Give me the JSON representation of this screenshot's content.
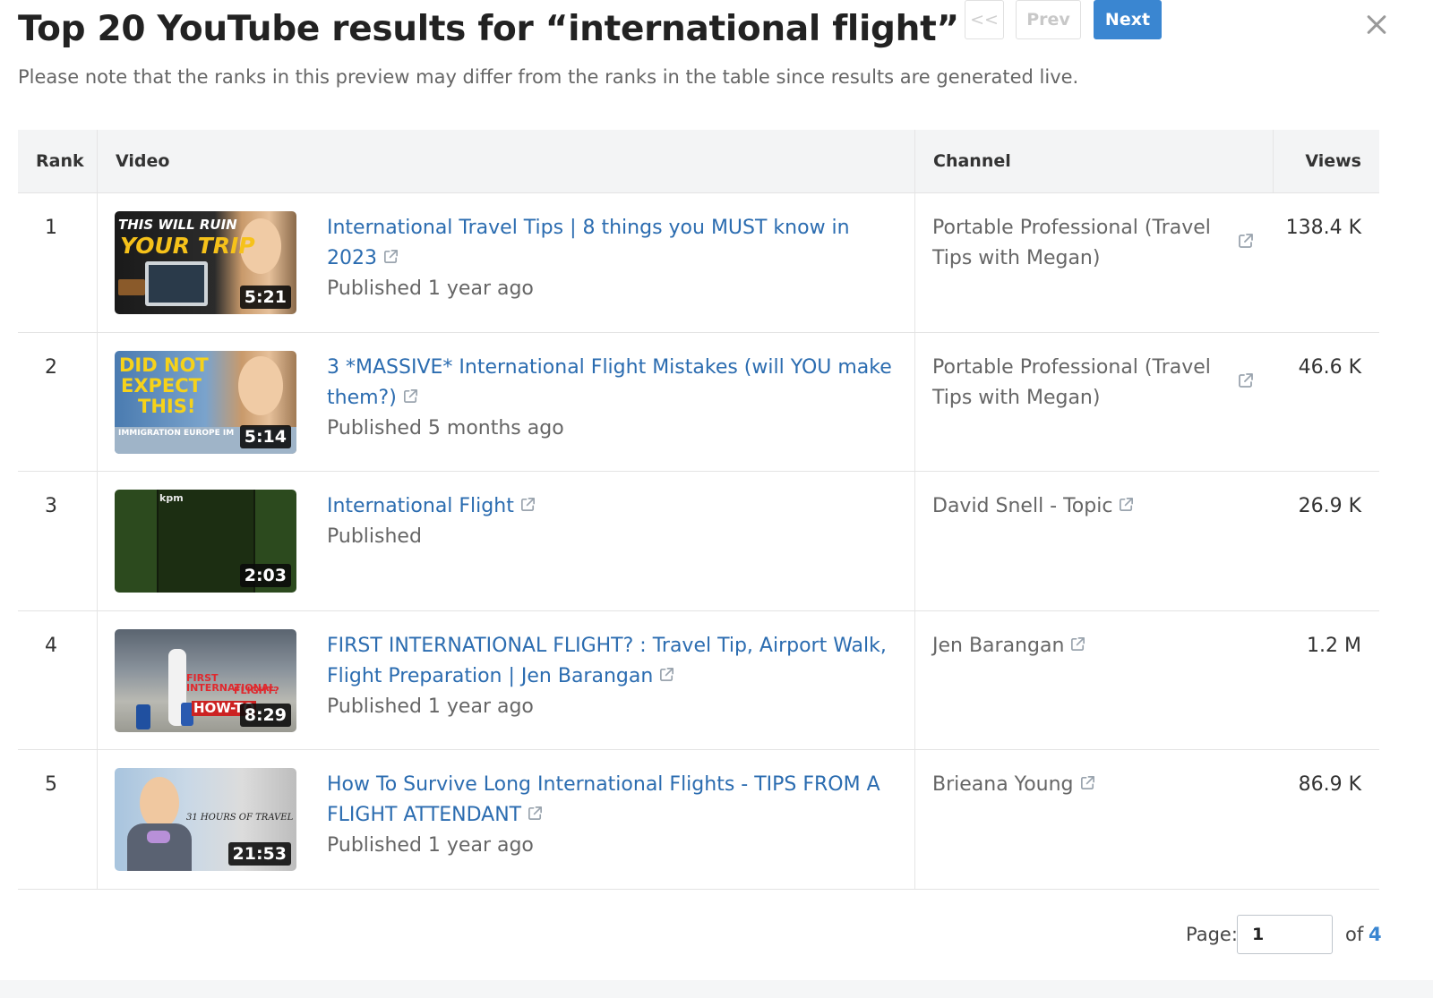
{
  "header": {
    "title": "Top 20 YouTube results for “international flight”",
    "subtitle": "Please note that the ranks in this preview may differ from the ranks in the table since results are generated live.",
    "close_icon": "close-icon"
  },
  "table": {
    "columns": {
      "rank": "Rank",
      "video": "Video",
      "channel": "Channel",
      "views": "Views"
    },
    "rows": [
      {
        "rank": "1",
        "thumb_line1": "THIS WILL RUIN",
        "thumb_line2": "YOUR TRIP",
        "duration": "5:21",
        "title": "International Travel Tips | 8 things you MUST know in 2023",
        "published": "Published 1 year ago",
        "channel": "Portable Professional (Travel Tips with Megan)",
        "views": "138.4 K"
      },
      {
        "rank": "2",
        "thumb_line1": "DID NOT",
        "thumb_line2": "EXPECT",
        "thumb_line3": "THIS!",
        "thumb_footer": "IMMIGRATION  EUROPE  IM",
        "duration": "5:14",
        "title": "3 *MASSIVE* International Flight Mistakes (will YOU make them?)",
        "published": "Published 5 months ago",
        "channel": "Portable Professional (Travel Tips with Megan)",
        "views": "46.6 K"
      },
      {
        "rank": "3",
        "thumb_label": "kpm",
        "duration": "2:03",
        "title": "International Flight",
        "published": "Published",
        "channel": "David Snell - Topic",
        "views": "26.9 K"
      },
      {
        "rank": "4",
        "thumb_line1": "FIRST INTERNATIONAL",
        "thumb_line2": "FLIGHT?",
        "thumb_line3": "HOW-TO",
        "duration": "8:29",
        "title": "FIRST INTERNATIONAL FLIGHT? : Travel Tip, Airport Walk, Flight Preparation | Jen Barangan",
        "published": "Published 1 year ago",
        "channel": "Jen Barangan",
        "views": "1.2 M"
      },
      {
        "rank": "5",
        "thumb_line1": "31 HOURS OF TRAVEL",
        "duration": "21:53",
        "title": "How To Survive Long International Flights - TIPS FROM A FLIGHT ATTENDANT",
        "published": "Published 1 year ago",
        "channel": "Brieana Young",
        "views": "86.9 K"
      }
    ]
  },
  "pagination": {
    "first_label": "<<",
    "prev_label": "Prev",
    "next_label": "Next",
    "page_label": "Page:",
    "current_page": "1",
    "of_label": "of",
    "total_pages": "4"
  },
  "colors": {
    "link": "#2b6cb0",
    "accent": "#3a86d1",
    "header_bg": "#f3f4f5",
    "muted_text": "#666666"
  },
  "icons": {
    "external_link": "external-link-icon",
    "close": "close-icon"
  }
}
